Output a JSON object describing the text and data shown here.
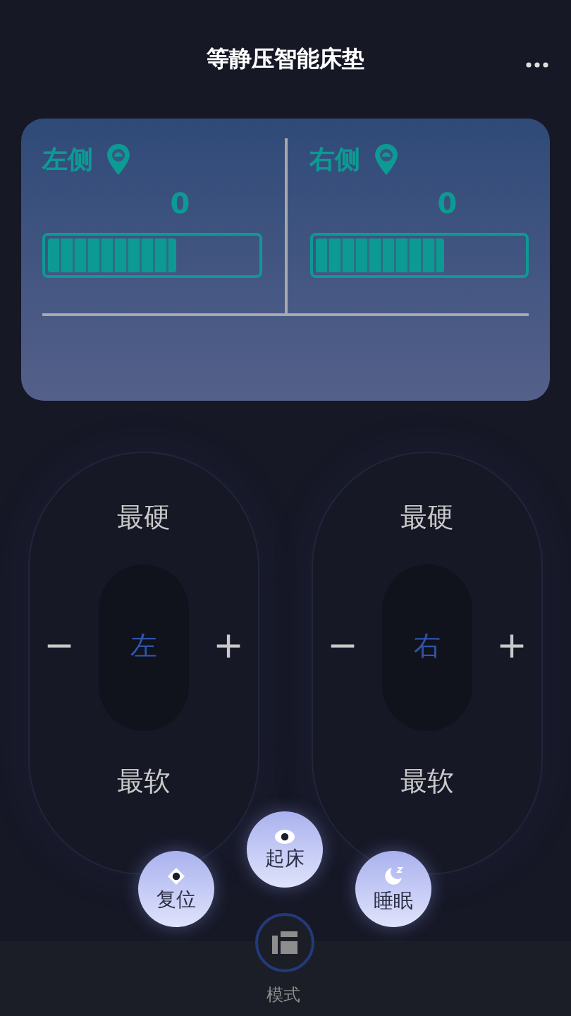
{
  "header": {
    "title": "等静压智能床垫"
  },
  "sides": [
    {
      "label": "左侧",
      "value": "0",
      "level": 0.62
    },
    {
      "label": "右侧",
      "value": "0",
      "level": 0.62
    }
  ],
  "controls": [
    {
      "top": "最硬",
      "minus": "−",
      "center": "左",
      "plus": "+",
      "bottom": "最软"
    },
    {
      "top": "最硬",
      "minus": "−",
      "center": "右",
      "plus": "+",
      "bottom": "最软"
    }
  ],
  "modes": [
    {
      "kind": "reset",
      "label": "复位"
    },
    {
      "kind": "wake",
      "label": "起床"
    },
    {
      "kind": "sleep",
      "label": "睡眠"
    }
  ],
  "tab_bar": {
    "label": "模式"
  }
}
